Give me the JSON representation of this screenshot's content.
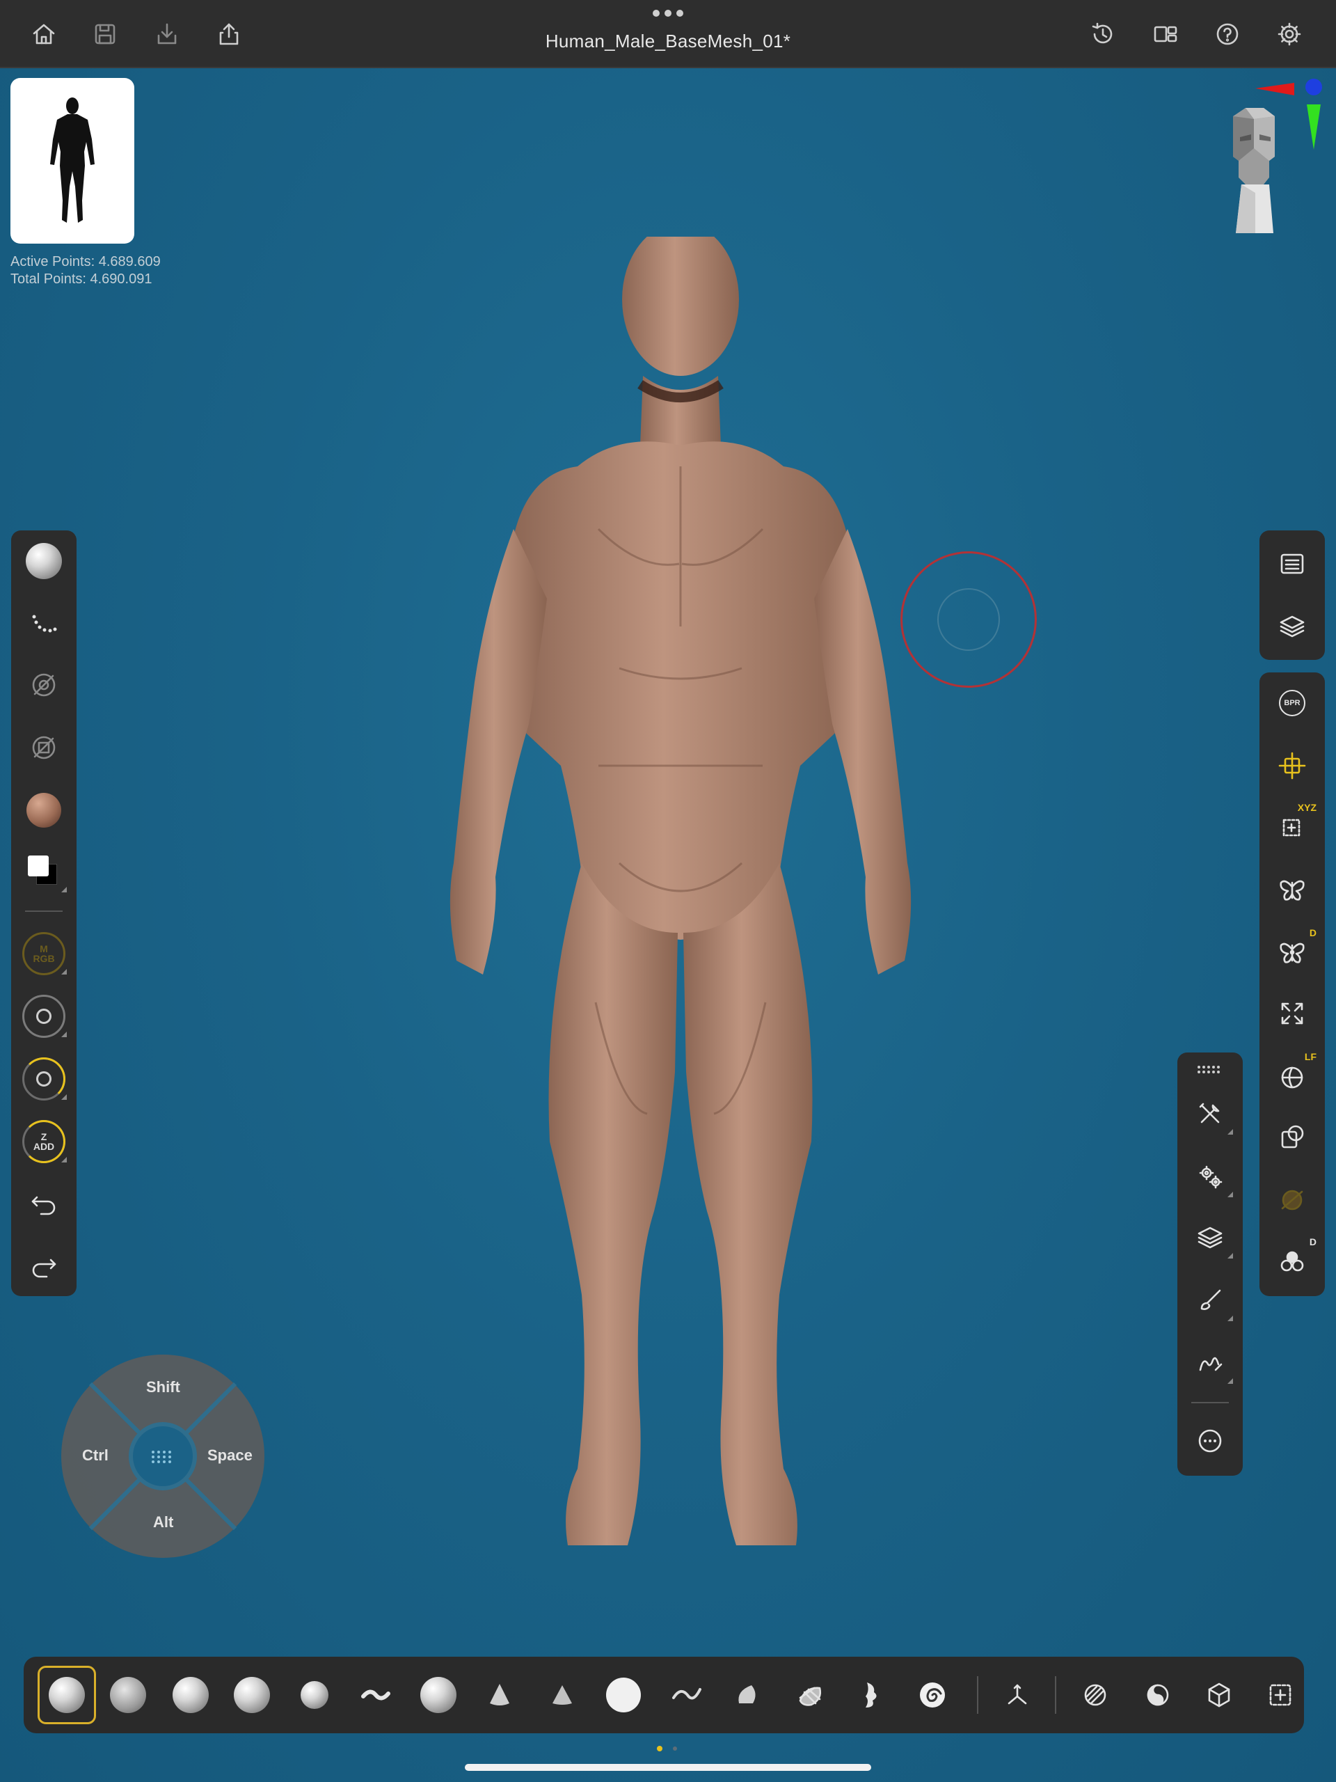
{
  "document": {
    "title": "Human_Male_BaseMesh_01*"
  },
  "topbar": {
    "left_icons": [
      "home-icon",
      "save-icon",
      "import-icon",
      "share-icon"
    ],
    "right_icons": [
      "history-icon",
      "layout-icon",
      "help-icon",
      "settings-icon"
    ]
  },
  "stats": {
    "active_points": "Active Points: 4.689.609",
    "total_points": "Total Points: 4.690.091"
  },
  "left_tray": {
    "mrgb_label_top": "M",
    "mrgb_label_bottom": "RGB",
    "zadd_label_top": "Z",
    "zadd_label_bottom": "ADD"
  },
  "right_tray": {
    "bpr_label": "BPR",
    "xyz_tag": "XYZ",
    "d_tag": "D",
    "lf_tag": "LF",
    "d_tag2": "D"
  },
  "modifier_pad": {
    "up": "Shift",
    "left": "Ctrl",
    "right": "Space",
    "down": "Alt"
  },
  "colors": {
    "viewport_bg": "#1a6287",
    "accent": "#e8c21d",
    "skin": "#b38a74",
    "cursor_ring": "#b33236"
  }
}
